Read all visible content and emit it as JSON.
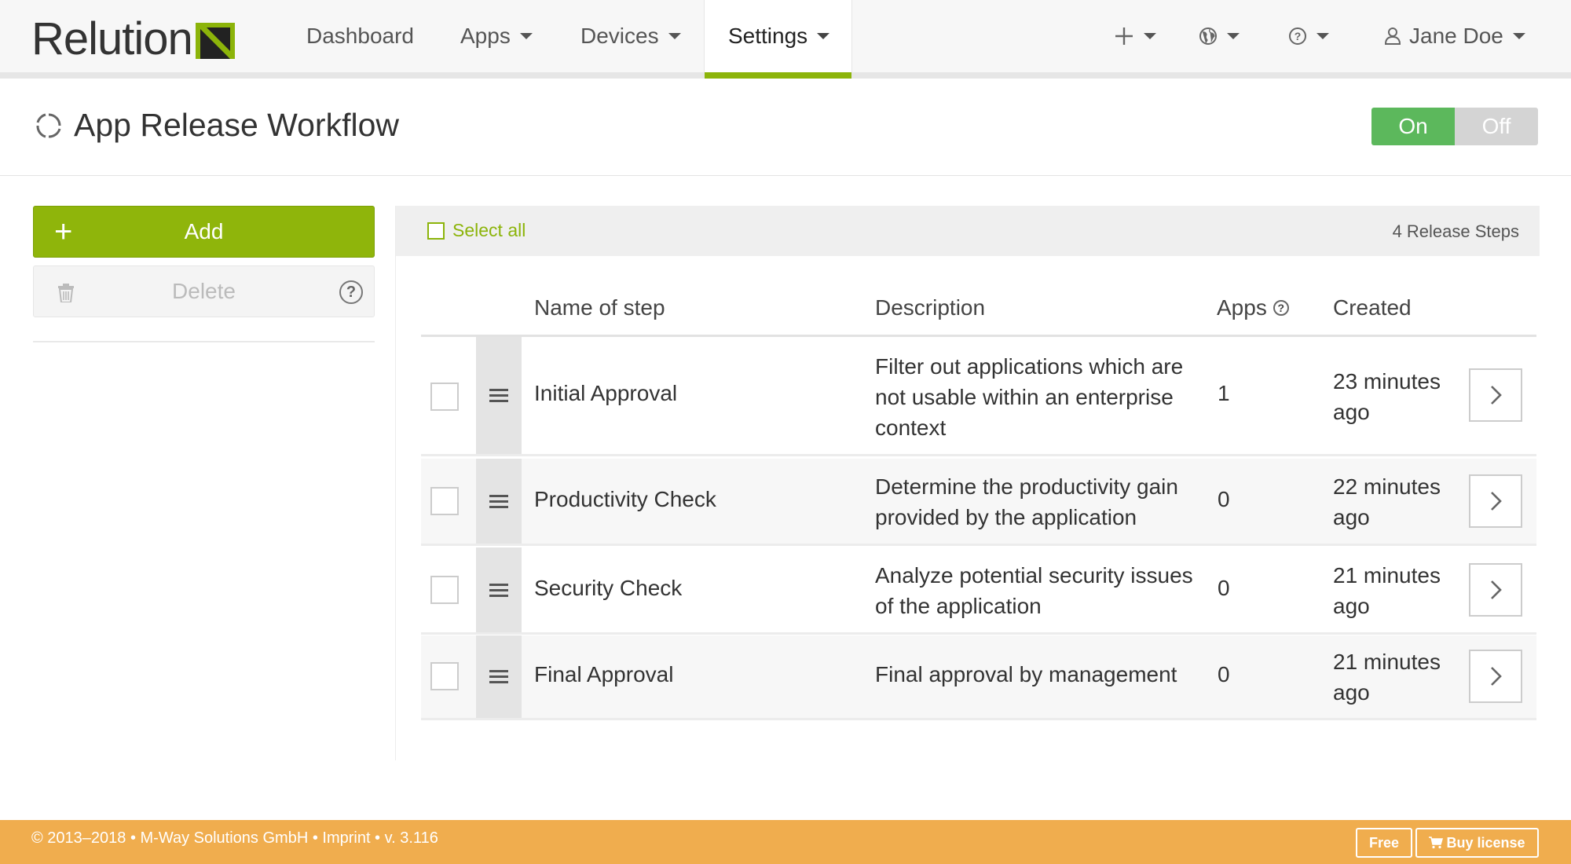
{
  "brand": {
    "name": "Relution"
  },
  "nav": {
    "items": [
      {
        "label": "Dashboard",
        "has_caret": false
      },
      {
        "label": "Apps",
        "has_caret": true
      },
      {
        "label": "Devices",
        "has_caret": true
      },
      {
        "label": "Settings",
        "has_caret": true,
        "active": true
      }
    ],
    "right": {
      "add_icon": "plus-icon",
      "globe_icon": "globe-icon",
      "help_icon": "help-icon",
      "user_icon": "user-icon",
      "user_name": "Jane Doe"
    }
  },
  "page": {
    "title": "App Release Workflow",
    "title_icon": "refresh-icon",
    "toggle": {
      "on_label": "On",
      "off_label": "Off",
      "state": "on"
    }
  },
  "sidebar": {
    "add_label": "Add",
    "add_symbol": "+",
    "delete_label": "Delete",
    "help_symbol": "?"
  },
  "list": {
    "select_all_label": "Select all",
    "count_label": "4 Release Steps",
    "columns": {
      "name": "Name of step",
      "description": "Description",
      "apps": "Apps",
      "created": "Created"
    },
    "rows": [
      {
        "name": "Initial Approval",
        "description": "Filter out applications which are not usable within an enterprise context",
        "apps": "1",
        "created": "23 minutes ago"
      },
      {
        "name": "Productivity Check",
        "description": "Determine the productivity gain provided by the application",
        "apps": "0",
        "created": "22 minutes ago"
      },
      {
        "name": "Security Check",
        "description": "Analyze potential security issues of the application",
        "apps": "0",
        "created": "21 minutes ago"
      },
      {
        "name": "Final Approval",
        "description": "Final approval by management",
        "apps": "0",
        "created": "21 minutes ago"
      }
    ]
  },
  "footer": {
    "copyright": "© 2013–2018 • M-Way Solutions GmbH • Imprint • v. 3.116",
    "free_label": "Free",
    "buy_label": "Buy license"
  },
  "colors": {
    "accent": "#8cb40a",
    "toggle_on": "#5cb85c",
    "footer": "#f0ad4e"
  }
}
